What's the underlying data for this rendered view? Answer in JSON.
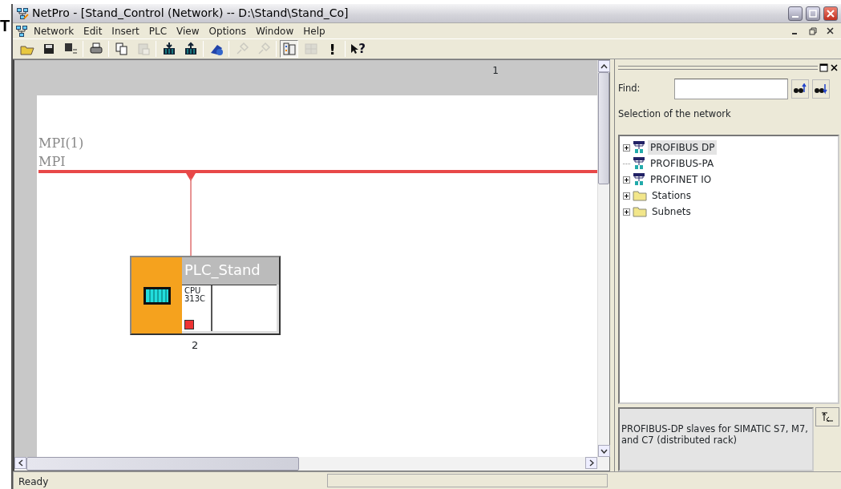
{
  "backdrop_text": "T",
  "window": {
    "title": "NetPro - [Stand_Control (Network) -- D:\\Stand\\Stand_Co]"
  },
  "menu": [
    "Network",
    "Edit",
    "Insert",
    "PLC",
    "View",
    "Options",
    "Window",
    "Help"
  ],
  "toolbar": [
    {
      "kind": "open",
      "disabled": false
    },
    {
      "kind": "save",
      "disabled": false
    },
    {
      "kind": "compile",
      "disabled": false
    },
    {
      "kind": "separator"
    },
    {
      "kind": "print",
      "disabled": false
    },
    {
      "kind": "separator"
    },
    {
      "kind": "copy",
      "disabled": false
    },
    {
      "kind": "paste",
      "disabled": true
    },
    {
      "kind": "separator"
    },
    {
      "kind": "download",
      "disabled": false
    },
    {
      "kind": "upload",
      "disabled": false
    },
    {
      "kind": "separator"
    },
    {
      "kind": "diagnose",
      "disabled": false
    },
    {
      "kind": "separator"
    },
    {
      "kind": "plug",
      "disabled": true
    },
    {
      "kind": "plug",
      "disabled": true
    },
    {
      "kind": "separator"
    },
    {
      "kind": "catalog",
      "disabled": false,
      "pressed": true
    },
    {
      "kind": "grid",
      "disabled": true,
      "pressed": false
    },
    {
      "kind": "important",
      "label": "!"
    },
    {
      "kind": "separator"
    },
    {
      "kind": "help",
      "label": "?"
    }
  ],
  "canvas": {
    "column_header": "1",
    "subnet": {
      "name": "MPI(1)",
      "type": "MPI"
    },
    "station": {
      "name": "PLC_Stand",
      "module": "CPU\n313C",
      "address": "2"
    }
  },
  "catalog": {
    "find_label": "Find:",
    "selection_label": "Selection of the network",
    "tree": [
      {
        "label": "PROFIBUS DP",
        "kind": "network",
        "expandable": true,
        "selected": true
      },
      {
        "label": "PROFIBUS-PA",
        "kind": "network",
        "expandable": false,
        "selected": false
      },
      {
        "label": "PROFINET IO",
        "kind": "network",
        "expandable": true,
        "selected": false
      },
      {
        "label": "Stations",
        "kind": "folder",
        "expandable": true,
        "selected": false
      },
      {
        "label": "Subnets",
        "kind": "folder",
        "expandable": true,
        "selected": false
      }
    ],
    "description": "PROFIBUS-DP slaves for SIMATIC S7, M7, and C7 (distributed rack)"
  },
  "status_bar": "Ready"
}
